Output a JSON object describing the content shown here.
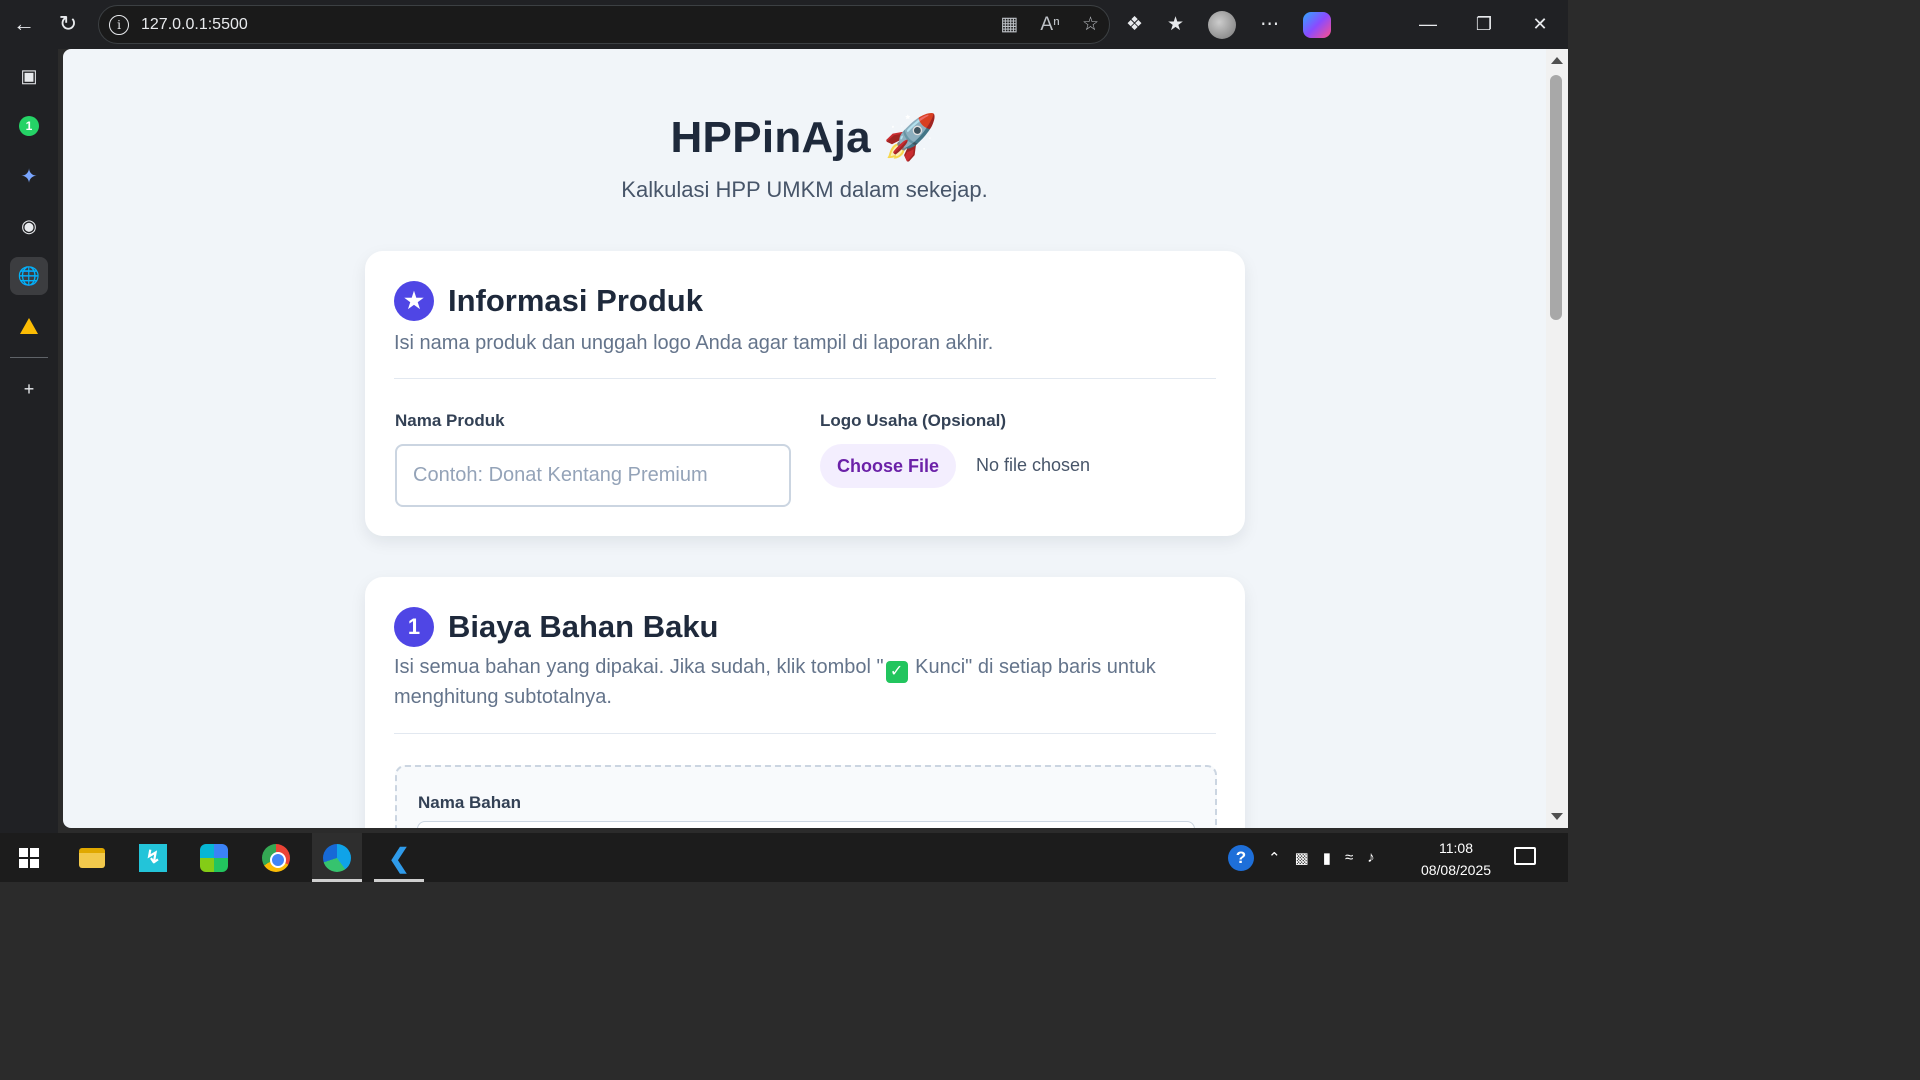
{
  "browser": {
    "url": "127.0.0.1:5500",
    "info_icon": "i"
  },
  "page": {
    "title": "HPPinAja 🚀",
    "subtitle": "Kalkulasi HPP UMKM dalam sekejap."
  },
  "product_card": {
    "badge": "★",
    "title": "Informasi Produk",
    "description": "Isi nama produk dan unggah logo Anda agar tampil di laporan akhir.",
    "name_label": "Nama Produk",
    "name_placeholder": "Contoh: Donat Kentang Premium",
    "logo_label": "Logo Usaha (Opsional)",
    "choose_file": "Choose File",
    "no_file": "No file chosen"
  },
  "materials_card": {
    "badge": "1",
    "title": "Biaya Bahan Baku",
    "description_before": "Isi semua bahan yang dipakai. Jika sudah, klik tombol \"",
    "check_icon": "✓",
    "description_after": " Kunci\" di setiap baris untuk menghitung subtotalnya.",
    "item_label": "Nama Bahan"
  },
  "taskbar": {
    "time": "11:08",
    "date": "08/08/2025"
  }
}
